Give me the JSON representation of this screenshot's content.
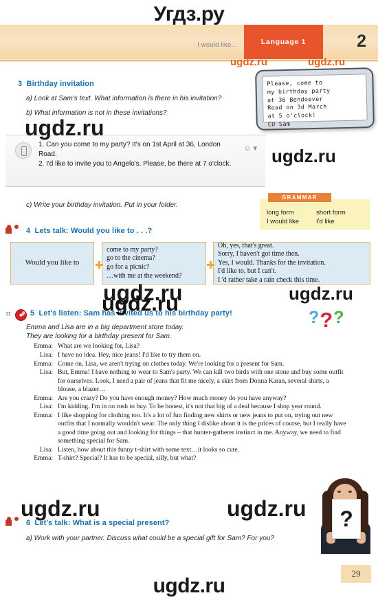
{
  "watermarks": {
    "top": "Угдз.ру",
    "bottom": "ugdz.ru",
    "small": "ugdz.ru",
    "medium": "ugdz.ru",
    "large": "ugdz.ru"
  },
  "header": {
    "left_label": "I would like...",
    "tab_label": "Language 1",
    "unit_number": "2"
  },
  "ex3": {
    "number": "3",
    "title": "Birthday invitation",
    "a": "a)  Look at Sam's text. What information is there in his invitation?",
    "b": "b)  What information is not in these invitations?",
    "c": "c)  Write your birthday invitation. Put in your folder.",
    "note": "Please, come to\nmy birthday party\nat 36 Bendoever\nRoad on 3d March\nat 5 o'clock!\nCU Sam",
    "sms": "1. Can you come to my party? It's on 1st April at 36, London Road.\n2. I'd like to invite you to Angelo's. Please, be there at 7 o'clock.",
    "sms_emoji": "☺ ▾"
  },
  "grammar": {
    "title": "GRAMMAR",
    "head_long": "long form",
    "head_short": "short form",
    "row_long": "I would like",
    "row_short": "I'd like"
  },
  "ex4": {
    "number": "4",
    "title": "Lets talk: Would you like to . . .?",
    "col_a": "Would you like to",
    "col_b": [
      "come to my party?",
      "go to the cinema?",
      "go for a picnic?",
      "…with me at the weekend?"
    ],
    "col_c": [
      "Oh, yes, that's great.",
      "Sorry, I haven't got time then.",
      "Yes, I would. Thanks for the invitation.",
      "I'd like to, but I can't.",
      "I 'd rather take a rain check this time."
    ]
  },
  "ex5": {
    "track": "11",
    "number": "5",
    "title": "Let's listen: Sam has invited us to his birthday party!",
    "intro_1": "Emma and Lisa are in a big department store today.",
    "intro_2": "They are looking for a birthday present for Sam.",
    "dialogue": [
      {
        "speaker": "Emma:",
        "text": "What are we looking for, Lisa?"
      },
      {
        "speaker": "Lisa:",
        "text": "I have no idea. Hey, nice jeans! I'd like to try them on."
      },
      {
        "speaker": "Emma:",
        "text": "Come on, Lisa, we aren't trying on clothes today. We're looking for a present for Sam."
      },
      {
        "speaker": "Lisa:",
        "text": "But, Emma! I have nothing to wear to Sam's party. We can kill two birds with one stone and buy some outfit for ourselves. Look, I need a pair of jeans that fit me nicely, a skirt from Donna Karan, several shirts, a blouse, a blazer…"
      },
      {
        "speaker": "Emma:",
        "text": "Are you crazy? Do you have enough money? How much money do you have anyway?"
      },
      {
        "speaker": "Lisa:",
        "text": "I'm kidding. I'm in no rush to buy. To be honest, it's not that big of a deal because I shop year round."
      },
      {
        "speaker": "Emma:",
        "text": "I like shopping for clothing too. It's a lot of fun finding new shirts or new jeans to put on, trying out new outfits that I normally wouldn't wear. The only thing I dislike about it is the prices of course, but I really have a good time going out and looking for things – that hunter-gatherer instinct in me. Anyway, we need to find something special for Sam."
      },
      {
        "speaker": "Lisa:",
        "text": "Listen, how about this funny t-shirt with some text…it looks so cute."
      },
      {
        "speaker": "Emma:",
        "text": "T-shirt? Special? It has to be special, silly, but what?"
      }
    ],
    "question_marks": [
      "?",
      "?",
      "?"
    ]
  },
  "ex6": {
    "number": "6",
    "title": "Let's talk: What is a special present?",
    "a": "a)  Work with your partner. Discuss what could be a special gift for Sam? For you?"
  },
  "photo": {
    "card_text": "?"
  },
  "page_number": "29",
  "colors": {
    "accent_orange": "#e8552c",
    "heading_blue": "#1b6faa",
    "banner": "#f7dcb4",
    "grammar_yellow": "#fbf3bd",
    "box_blue": "#dceaf4",
    "box_border": "#e2b973",
    "page_tab": "#f6dcb2"
  }
}
